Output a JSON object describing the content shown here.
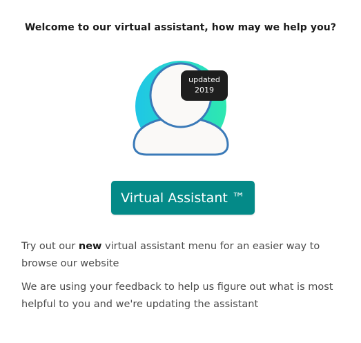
{
  "heading": "Welcome to our virtual assistant, how may we help you?",
  "badge": {
    "line1": "updated",
    "line2": "2019"
  },
  "button": {
    "label": "Virtual Assistant ™"
  },
  "paragraph1": {
    "before": "Try out our ",
    "emphasis": "new",
    "after": " virtual assistant menu for an easier way to browse our website"
  },
  "paragraph2": "We are using your feedback to help us figure out what is most helpful to you and we're updating the assistant",
  "colors": {
    "accent": "#048a88",
    "avatar_gradient_start": "#1fc6e6",
    "avatar_gradient_end": "#2ee8b0",
    "avatar_outline": "#3a7ab8",
    "badge_bg": "#1e1e1e"
  },
  "icons": {
    "avatar": "user-avatar-icon"
  }
}
